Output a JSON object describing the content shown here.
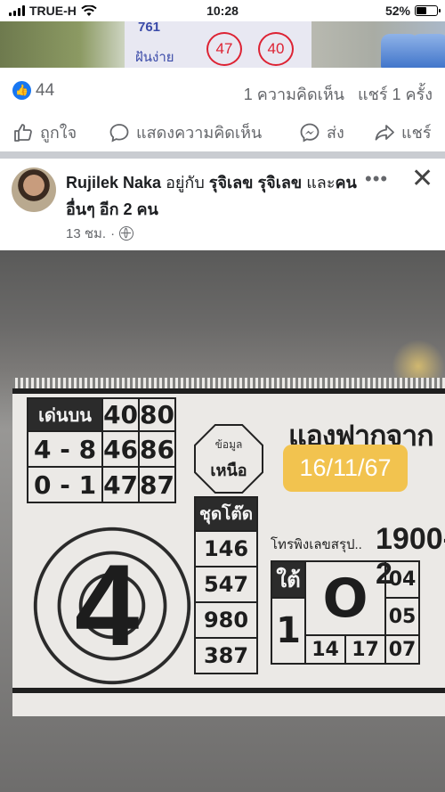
{
  "status_bar": {
    "carrier": "TRUE-H",
    "time": "10:28",
    "battery": "52%",
    "battery_level": 0.52
  },
  "top_photo": {
    "text_top": "761",
    "text_bottom": "ฝันง่าย",
    "circle_left": "47",
    "circle_right": "40"
  },
  "reactions": {
    "like_count": "44",
    "comments": "1 ความคิดเห็น",
    "shares": "แชร์ 1 ครั้ง"
  },
  "actions": {
    "like": "ถูกใจ",
    "comment": "แสดงความคิดเห็น",
    "send": "ส่ง",
    "share": "แชร์"
  },
  "post": {
    "author": "Rujilek Naka",
    "with_word": "อยู่กับ",
    "tagged": "รุจิเลข รุจิเลข",
    "and_others_word": "และ",
    "others": "คนอื่นๆ อีก 2 คน",
    "time": "13 ชม.",
    "dot": "·",
    "more": "•••",
    "close": "✕"
  },
  "lottery": {
    "main_table": {
      "header": "เด่นบน",
      "rows": [
        [
          "เด่นบน",
          "40",
          "80"
        ],
        [
          "4 - 8",
          "46",
          "86"
        ],
        [
          "0 - 1",
          "47",
          "87"
        ]
      ]
    },
    "octagon_top": "ข้อมูล",
    "octagon_bottom": "เหนือ",
    "set_header": "ชุดโต๊ด",
    "sets": [
      "146",
      "547",
      "980",
      "387"
    ],
    "big_digit": "4",
    "headline": "แองฟากจาก",
    "hotline_label": "โทรพิงเลขสรุป..",
    "hotline_number": "1900-2",
    "date": "16/11/67",
    "south_label": "ใต้",
    "south_digit": "1",
    "south_big": "O",
    "south_bottom": [
      "14",
      "17",
      "07"
    ],
    "south_right": [
      "04",
      "05"
    ]
  }
}
